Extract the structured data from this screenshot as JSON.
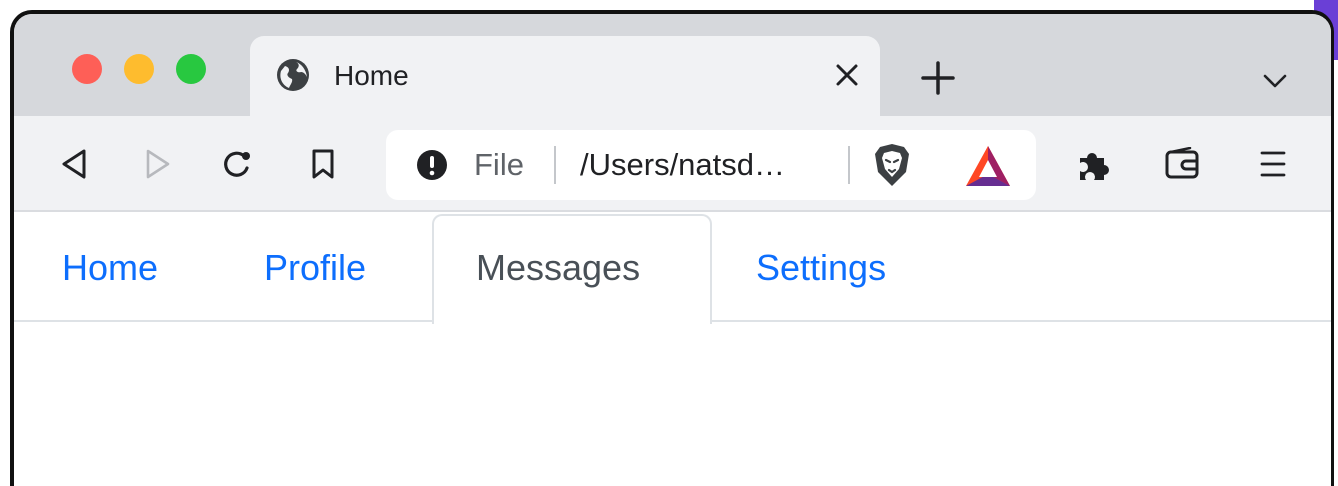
{
  "browser": {
    "tab": {
      "title": "Home",
      "icon": "globe-icon"
    },
    "omnibox": {
      "scheme": "File",
      "url": "/Users/natsd…",
      "info_icon": "info-icon",
      "shield_icon": "brave-shield-icon",
      "rewards_icon": "bat-rewards-icon"
    },
    "toolbar_icons": [
      "back-icon",
      "forward-icon",
      "reload-icon",
      "bookmark-icon",
      "extensions-icon",
      "wallet-icon",
      "menu-icon"
    ]
  },
  "page": {
    "nav": {
      "home": "Home",
      "profile": "Profile",
      "messages": "Messages",
      "settings": "Settings",
      "active": "Messages"
    }
  },
  "colors": {
    "link": "#0d6efd",
    "active_tab_text": "#495057",
    "tabstrip": "#d6d8dc",
    "toolbar": "#f1f2f4"
  }
}
